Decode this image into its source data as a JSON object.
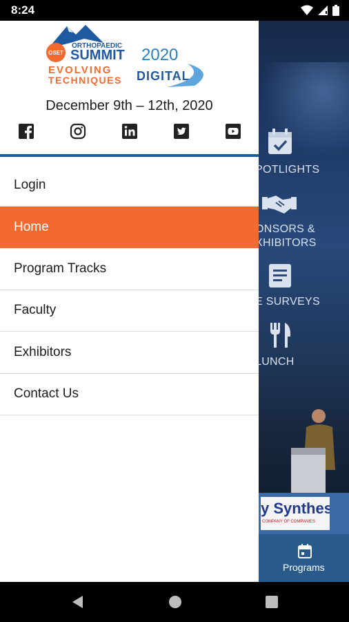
{
  "status_bar": {
    "time": "8:24"
  },
  "background_app": {
    "tiles": [
      {
        "label": "POTLIGHTS",
        "icon": "calendar-check-icon"
      },
      {
        "label": "ONSORS &",
        "label2": "XHIBITORS",
        "icon": "handshake-icon"
      },
      {
        "label": "E SURVEYS",
        "icon": "document-icon"
      },
      {
        "label": "LUNCH",
        "icon": "fork-knife-icon"
      }
    ],
    "sponsor": {
      "text": "y Synthes",
      "sub": "COMPANY OF COMPANIES"
    },
    "bottom_nav": {
      "label": "Programs",
      "icon": "calendar-icon"
    }
  },
  "drawer": {
    "logo": {
      "badge": "OSET",
      "line_top": "ORTHOPAEDIC",
      "line_main": "SUMMIT",
      "year": "2020",
      "tag1": "EVOLVING",
      "tag2": "TECHNIQUES",
      "tag3": "DIGITAL"
    },
    "dates": "December 9th – 12th, 2020",
    "social": [
      "facebook-icon",
      "instagram-icon",
      "linkedin-icon",
      "twitter-icon",
      "youtube-icon"
    ],
    "menu": [
      {
        "label": "Login",
        "active": false
      },
      {
        "label": "Home",
        "active": true
      },
      {
        "label": "Program Tracks",
        "active": false
      },
      {
        "label": "Faculty",
        "active": false
      },
      {
        "label": "Exhibitors",
        "active": false
      },
      {
        "label": "Contact Us",
        "active": false
      }
    ]
  },
  "colors": {
    "accent": "#f26a30",
    "brand_blue": "#1f5aa0",
    "nav_blue": "#285b8c"
  }
}
